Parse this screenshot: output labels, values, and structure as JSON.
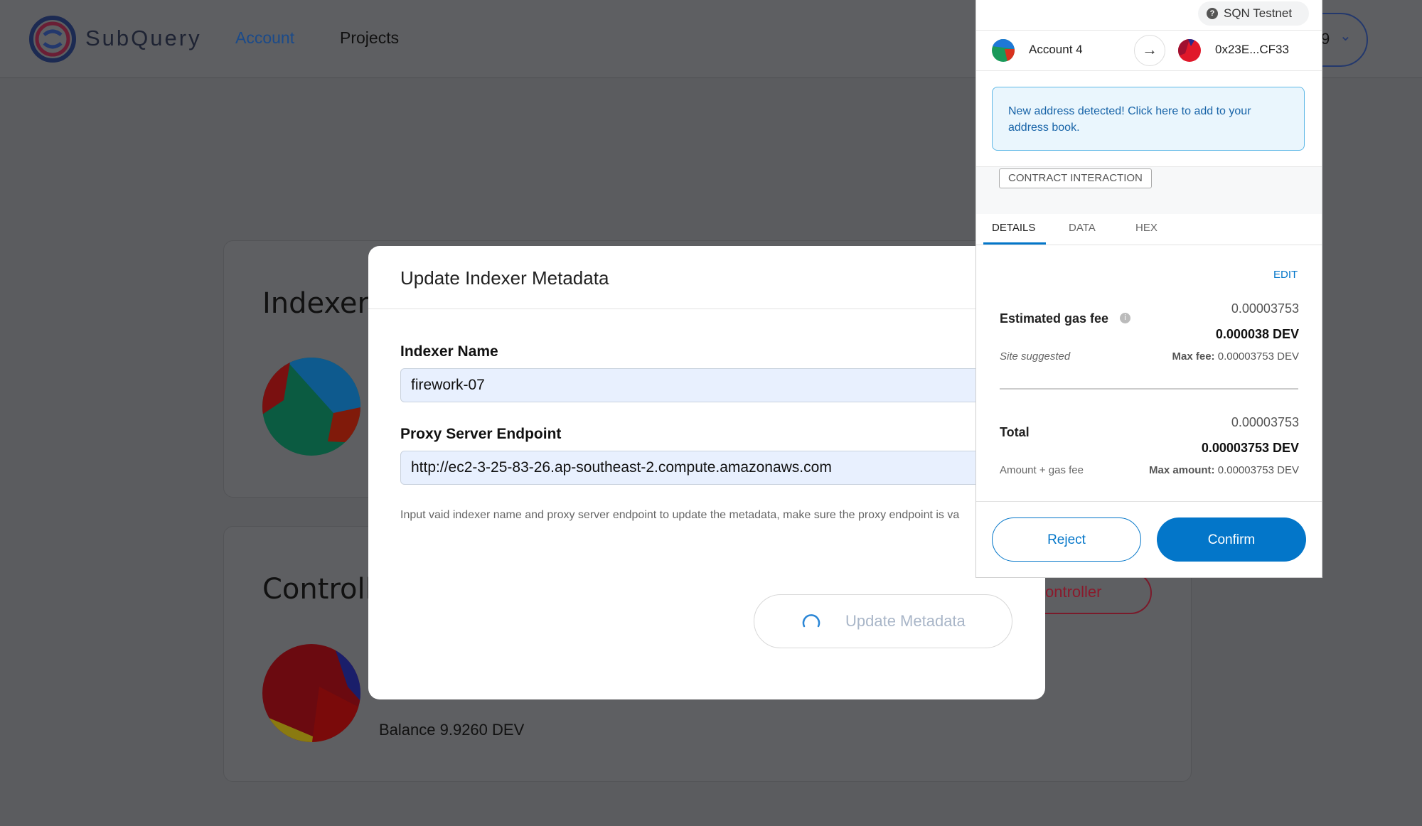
{
  "header": {
    "logo_text": "SubQuery",
    "nav": {
      "account": "Account",
      "projects": "Projects"
    },
    "wallet_chip_text": "9"
  },
  "cards": {
    "indexer_title": "Indexer A",
    "controller_title": "Controlle",
    "balance": "Balance 9.9260 DEV",
    "controller_button": "ontroller"
  },
  "modal": {
    "title": "Update Indexer Metadata",
    "name_label": "Indexer Name",
    "name_value": "firework-07",
    "endpoint_label": "Proxy Server Endpoint",
    "endpoint_value": "http://ec2-3-25-83-26.ap-southeast-2.compute.amazonaws.com",
    "help_text": "Input vaid indexer name and proxy server endpoint to update the metadata, make sure the proxy endpoint is va",
    "update_button": "Update Metadata"
  },
  "wallet": {
    "network": "SQN Testnet",
    "from_account": "Account 4",
    "to_address": "0x23E...CF33",
    "notice": "New address detected! Click here to add to your address book.",
    "tag": "CONTRACT INTERACTION",
    "tabs": [
      "DETAILS",
      "DATA",
      "HEX"
    ],
    "edit": "EDIT",
    "gas": {
      "label": "Estimated gas fee",
      "value_small": "0.00003753",
      "value_bold": "0.000038 DEV",
      "site_suggested": "Site suggested",
      "max_fee_label": "Max fee:",
      "max_fee_value": "0.00003753 DEV"
    },
    "total": {
      "label": "Total",
      "value_small": "0.00003753",
      "value_bold": "0.00003753 DEV",
      "sub_label": "Amount + gas fee",
      "max_amount_label": "Max amount:",
      "max_amount_value": "0.00003753 DEV"
    },
    "reject": "Reject",
    "confirm": "Confirm",
    "colors": {
      "accent": "#0376c9",
      "notice_bg": "#eaf6fd"
    }
  }
}
